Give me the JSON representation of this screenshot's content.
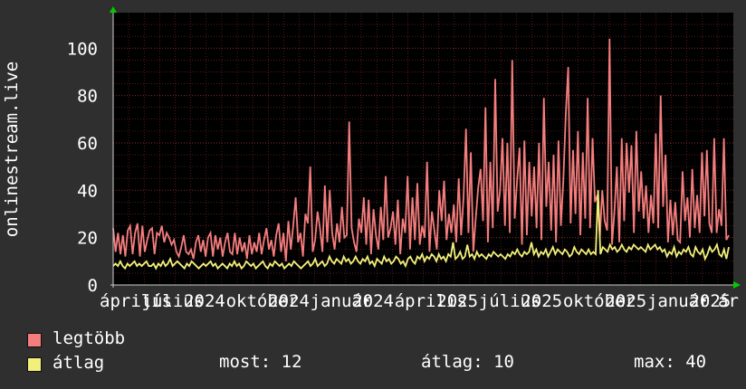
{
  "chart_data": {
    "type": "area",
    "ylabel": "onlinestream.live",
    "ylim": [
      0,
      115
    ],
    "y_ticks": [
      0,
      20,
      40,
      60,
      80,
      100
    ],
    "x_tick_labels": [
      "április",
      "július",
      "2024",
      "október",
      "2024",
      "január",
      "2024",
      "április",
      "2025",
      "július",
      "2025",
      "október",
      "2025",
      "január",
      "2025",
      "ár 20"
    ],
    "grid": true,
    "background": "#000000",
    "colors": {
      "max": "#f57d7d",
      "avg": "#f2f07a",
      "grid": "#8a2b2b",
      "axis": "#00cc00"
    },
    "series": [
      {
        "name": "legtöbb",
        "values": [
          24,
          14,
          22,
          13,
          21,
          12,
          23,
          25,
          13,
          22,
          26,
          12,
          25,
          14,
          19,
          23,
          24,
          13,
          22,
          21,
          25,
          18,
          22,
          20,
          17,
          19,
          14,
          12,
          16,
          21,
          14,
          13,
          15,
          11,
          18,
          21,
          14,
          19,
          12,
          20,
          22,
          12,
          21,
          15,
          20,
          12,
          18,
          22,
          14,
          13,
          22,
          13,
          20,
          14,
          18,
          11,
          21,
          13,
          18,
          14,
          22,
          13,
          19,
          24,
          15,
          19,
          12,
          21,
          26,
          14,
          22,
          10,
          27,
          15,
          25,
          37,
          18,
          22,
          12,
          30,
          26,
          50,
          14,
          19,
          31,
          24,
          14,
          42,
          18,
          40,
          22,
          15,
          26,
          18,
          33,
          20,
          21,
          69,
          24,
          18,
          14,
          28,
          22,
          37,
          17,
          36,
          13,
          32,
          21,
          15,
          33,
          19,
          46,
          20,
          24,
          31,
          17,
          36,
          13,
          28,
          22,
          46,
          15,
          37,
          19,
          43,
          17,
          25,
          20,
          52,
          14,
          31,
          23,
          15,
          40,
          27,
          44,
          19,
          30,
          22,
          34,
          18,
          45,
          21,
          37,
          66,
          22,
          56,
          14,
          28,
          41,
          49,
          27,
          75,
          18,
          52,
          24,
          87,
          31,
          40,
          62,
          25,
          60,
          22,
          95,
          28,
          44,
          58,
          17,
          61,
          21,
          52,
          29,
          50,
          24,
          60,
          19,
          79,
          33,
          52,
          23,
          55,
          18,
          61,
          25,
          44,
          72,
          92,
          26,
          57,
          30,
          65,
          21,
          56,
          28,
          79,
          24,
          62,
          35,
          38,
          20,
          40,
          27,
          23,
          104,
          17,
          31,
          50,
          18,
          62,
          27,
          60,
          39,
          59,
          22,
          65,
          31,
          48,
          28,
          42,
          22,
          38,
          26,
          64,
          24,
          80,
          33,
          55,
          18,
          36,
          21,
          35,
          19,
          18,
          48,
          27,
          37,
          20,
          49,
          24,
          38,
          22,
          56,
          29,
          57,
          26,
          22,
          62,
          22,
          32,
          25,
          62,
          19,
          21
        ]
      },
      {
        "name": "átlag",
        "values": [
          8,
          9,
          8,
          10,
          8,
          7,
          9,
          8,
          9,
          10,
          8,
          9,
          8,
          9,
          10,
          8,
          8,
          9,
          7,
          9,
          8,
          10,
          8,
          9,
          11,
          8,
          9,
          10,
          9,
          8,
          7,
          9,
          8,
          10,
          9,
          8,
          7,
          8,
          9,
          8,
          9,
          10,
          8,
          9,
          7,
          8,
          9,
          8,
          7,
          9,
          8,
          10,
          8,
          9,
          7,
          8,
          10,
          9,
          8,
          9,
          7,
          8,
          9,
          10,
          8,
          7,
          9,
          8,
          10,
          9,
          8,
          9,
          7,
          8,
          9,
          8,
          10,
          9,
          8,
          7,
          8,
          9,
          10,
          8,
          9,
          11,
          8,
          9,
          10,
          8,
          9,
          12,
          10,
          9,
          11,
          10,
          9,
          12,
          10,
          11,
          9,
          10,
          12,
          10,
          9,
          11,
          10,
          12,
          9,
          10,
          8,
          11,
          10,
          9,
          12,
          10,
          11,
          9,
          10,
          12,
          11,
          9,
          10,
          8,
          11,
          12,
          10,
          9,
          12,
          11,
          13,
          10,
          12,
          11,
          13,
          12,
          10,
          13,
          11,
          12,
          10,
          13,
          12,
          18,
          11,
          12,
          14,
          11,
          12,
          17,
          12,
          13,
          11,
          14,
          12,
          13,
          12,
          11,
          13,
          12,
          14,
          13,
          12,
          13,
          12,
          11,
          13,
          12,
          14,
          13,
          15,
          13,
          12,
          14,
          13,
          14,
          18,
          13,
          15,
          12,
          14,
          13,
          15,
          12,
          14,
          16,
          13,
          15,
          14,
          13,
          15,
          14,
          12,
          13,
          16,
          14,
          13,
          15,
          14,
          13,
          15,
          13,
          14,
          13,
          40,
          13,
          16,
          15,
          14,
          17,
          15,
          16,
          14,
          15,
          17,
          15,
          14,
          16,
          15,
          17,
          16,
          15,
          16,
          15,
          14,
          17,
          15,
          16,
          17,
          15,
          16,
          14,
          15,
          12,
          14,
          13,
          16,
          12,
          14,
          13,
          15,
          14,
          16,
          13,
          12,
          16,
          14,
          13,
          15,
          11,
          13,
          16,
          14,
          15,
          17,
          13,
          12,
          15,
          11,
          16
        ]
      }
    ]
  },
  "legend": {
    "max_label": "legtöbb",
    "avg_label": "átlag",
    "stats": {
      "now": "most: 12",
      "avg": "átlag: 10",
      "max": "max: 40"
    }
  }
}
